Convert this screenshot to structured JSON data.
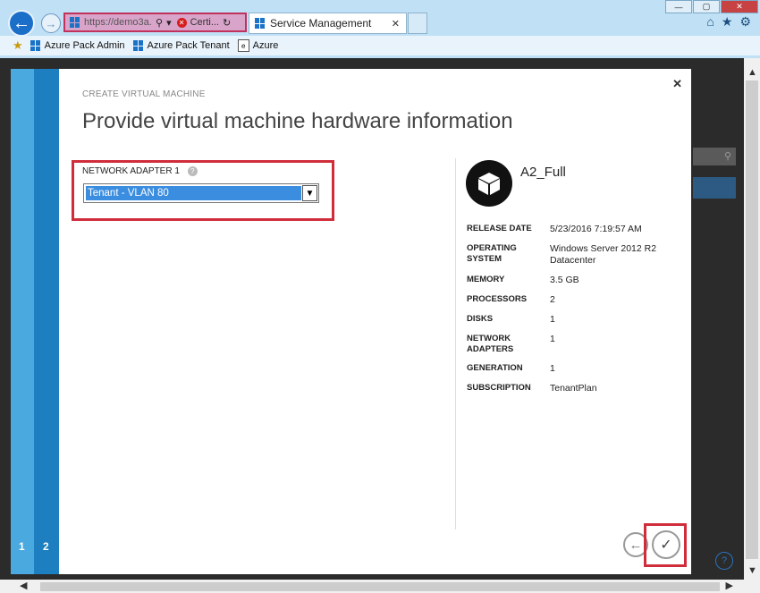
{
  "browser": {
    "address_url": "https://demo3a...",
    "cert_label": "Certi...",
    "tab_title": "Service Management",
    "favorites": [
      {
        "label": "Azure Pack Admin",
        "icon": "windows-logo-icon"
      },
      {
        "label": "Azure Pack Tenant",
        "icon": "windows-logo-icon"
      },
      {
        "label": "Azure",
        "icon": "page-icon"
      }
    ]
  },
  "wizard": {
    "steps": [
      "1",
      "2"
    ],
    "subtitle": "CREATE VIRTUAL MACHINE",
    "title": "Provide virtual machine hardware information",
    "network_adapter": {
      "label": "NETWORK ADAPTER 1",
      "help_glyph": "?",
      "selected": "Tenant - VLAN 80"
    },
    "vm": {
      "name": "A2_Full",
      "details": [
        {
          "key": "RELEASE DATE",
          "value": "5/23/2016 7:19:57 AM"
        },
        {
          "key": "OPERATING SYSTEM",
          "value": "Windows Server 2012 R2 Datacenter"
        },
        {
          "key": "MEMORY",
          "value": "3.5 GB"
        },
        {
          "key": "PROCESSORS",
          "value": "2"
        },
        {
          "key": "DISKS",
          "value": "1"
        },
        {
          "key": "NETWORK ADAPTERS",
          "value": "1"
        },
        {
          "key": "GENERATION",
          "value": "1"
        },
        {
          "key": "SUBSCRIPTION",
          "value": "TenantPlan"
        }
      ]
    }
  },
  "colors": {
    "accent": "#2f8fcf",
    "highlight": "#d02d3b",
    "select_bg": "#3b8de0"
  }
}
